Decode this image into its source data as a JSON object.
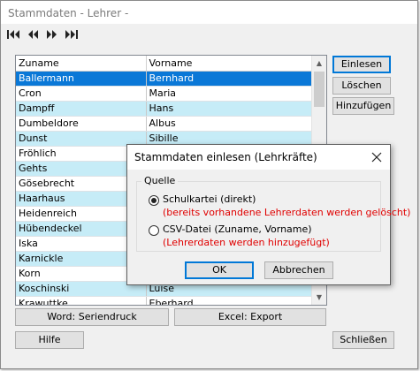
{
  "window": {
    "title": "Stammdaten - Lehrer -"
  },
  "navigation": {
    "icons": [
      "first-record-icon",
      "previous-record-icon",
      "next-record-icon",
      "last-record-icon"
    ]
  },
  "list": {
    "columns": [
      "Zuname",
      "Vorname"
    ],
    "rows": [
      [
        "Ballermann",
        "Bernhard"
      ],
      [
        "Cron",
        "Maria"
      ],
      [
        "Dampff",
        "Hans"
      ],
      [
        "Dumbeldore",
        "Albus"
      ],
      [
        "Dunst",
        "Sibille"
      ],
      [
        "Fröhlich",
        ""
      ],
      [
        "Gehts",
        ""
      ],
      [
        "Gösebrecht",
        ""
      ],
      [
        "Haarhaus",
        ""
      ],
      [
        "Heidenreich",
        ""
      ],
      [
        "Hübendeckel",
        ""
      ],
      [
        "Iska",
        ""
      ],
      [
        "Karnickle",
        ""
      ],
      [
        "Korn",
        ""
      ],
      [
        "Koschinski",
        "Luise"
      ],
      [
        "Krawuttke",
        "Eberhard"
      ]
    ],
    "selected_row": 0,
    "colors": {
      "selected": "#0a78d7",
      "alternate": "#c6ecf7"
    }
  },
  "side_buttons": {
    "read": "Einlesen",
    "delete": "Löschen",
    "add": "Hinzufügen"
  },
  "bottom_buttons": {
    "word": "Word: Seriendruck",
    "excel": "Excel: Export",
    "help": "Hilfe",
    "close": "Schließen"
  },
  "dialog": {
    "title": "Stammdaten einlesen (Lehrkräfte)",
    "group_label": "Quelle",
    "option1": {
      "label": "Schulkartei (direkt)",
      "note": "(bereits vorhandene Lehrerdaten werden gelöscht)",
      "selected": true
    },
    "option2": {
      "label": "CSV-Datei (Zuname, Vorname)",
      "note": "(Lehrerdaten werden hinzugefügt)",
      "selected": false
    },
    "ok": "OK",
    "cancel": "Abbrechen",
    "note_color": "#e00000"
  }
}
